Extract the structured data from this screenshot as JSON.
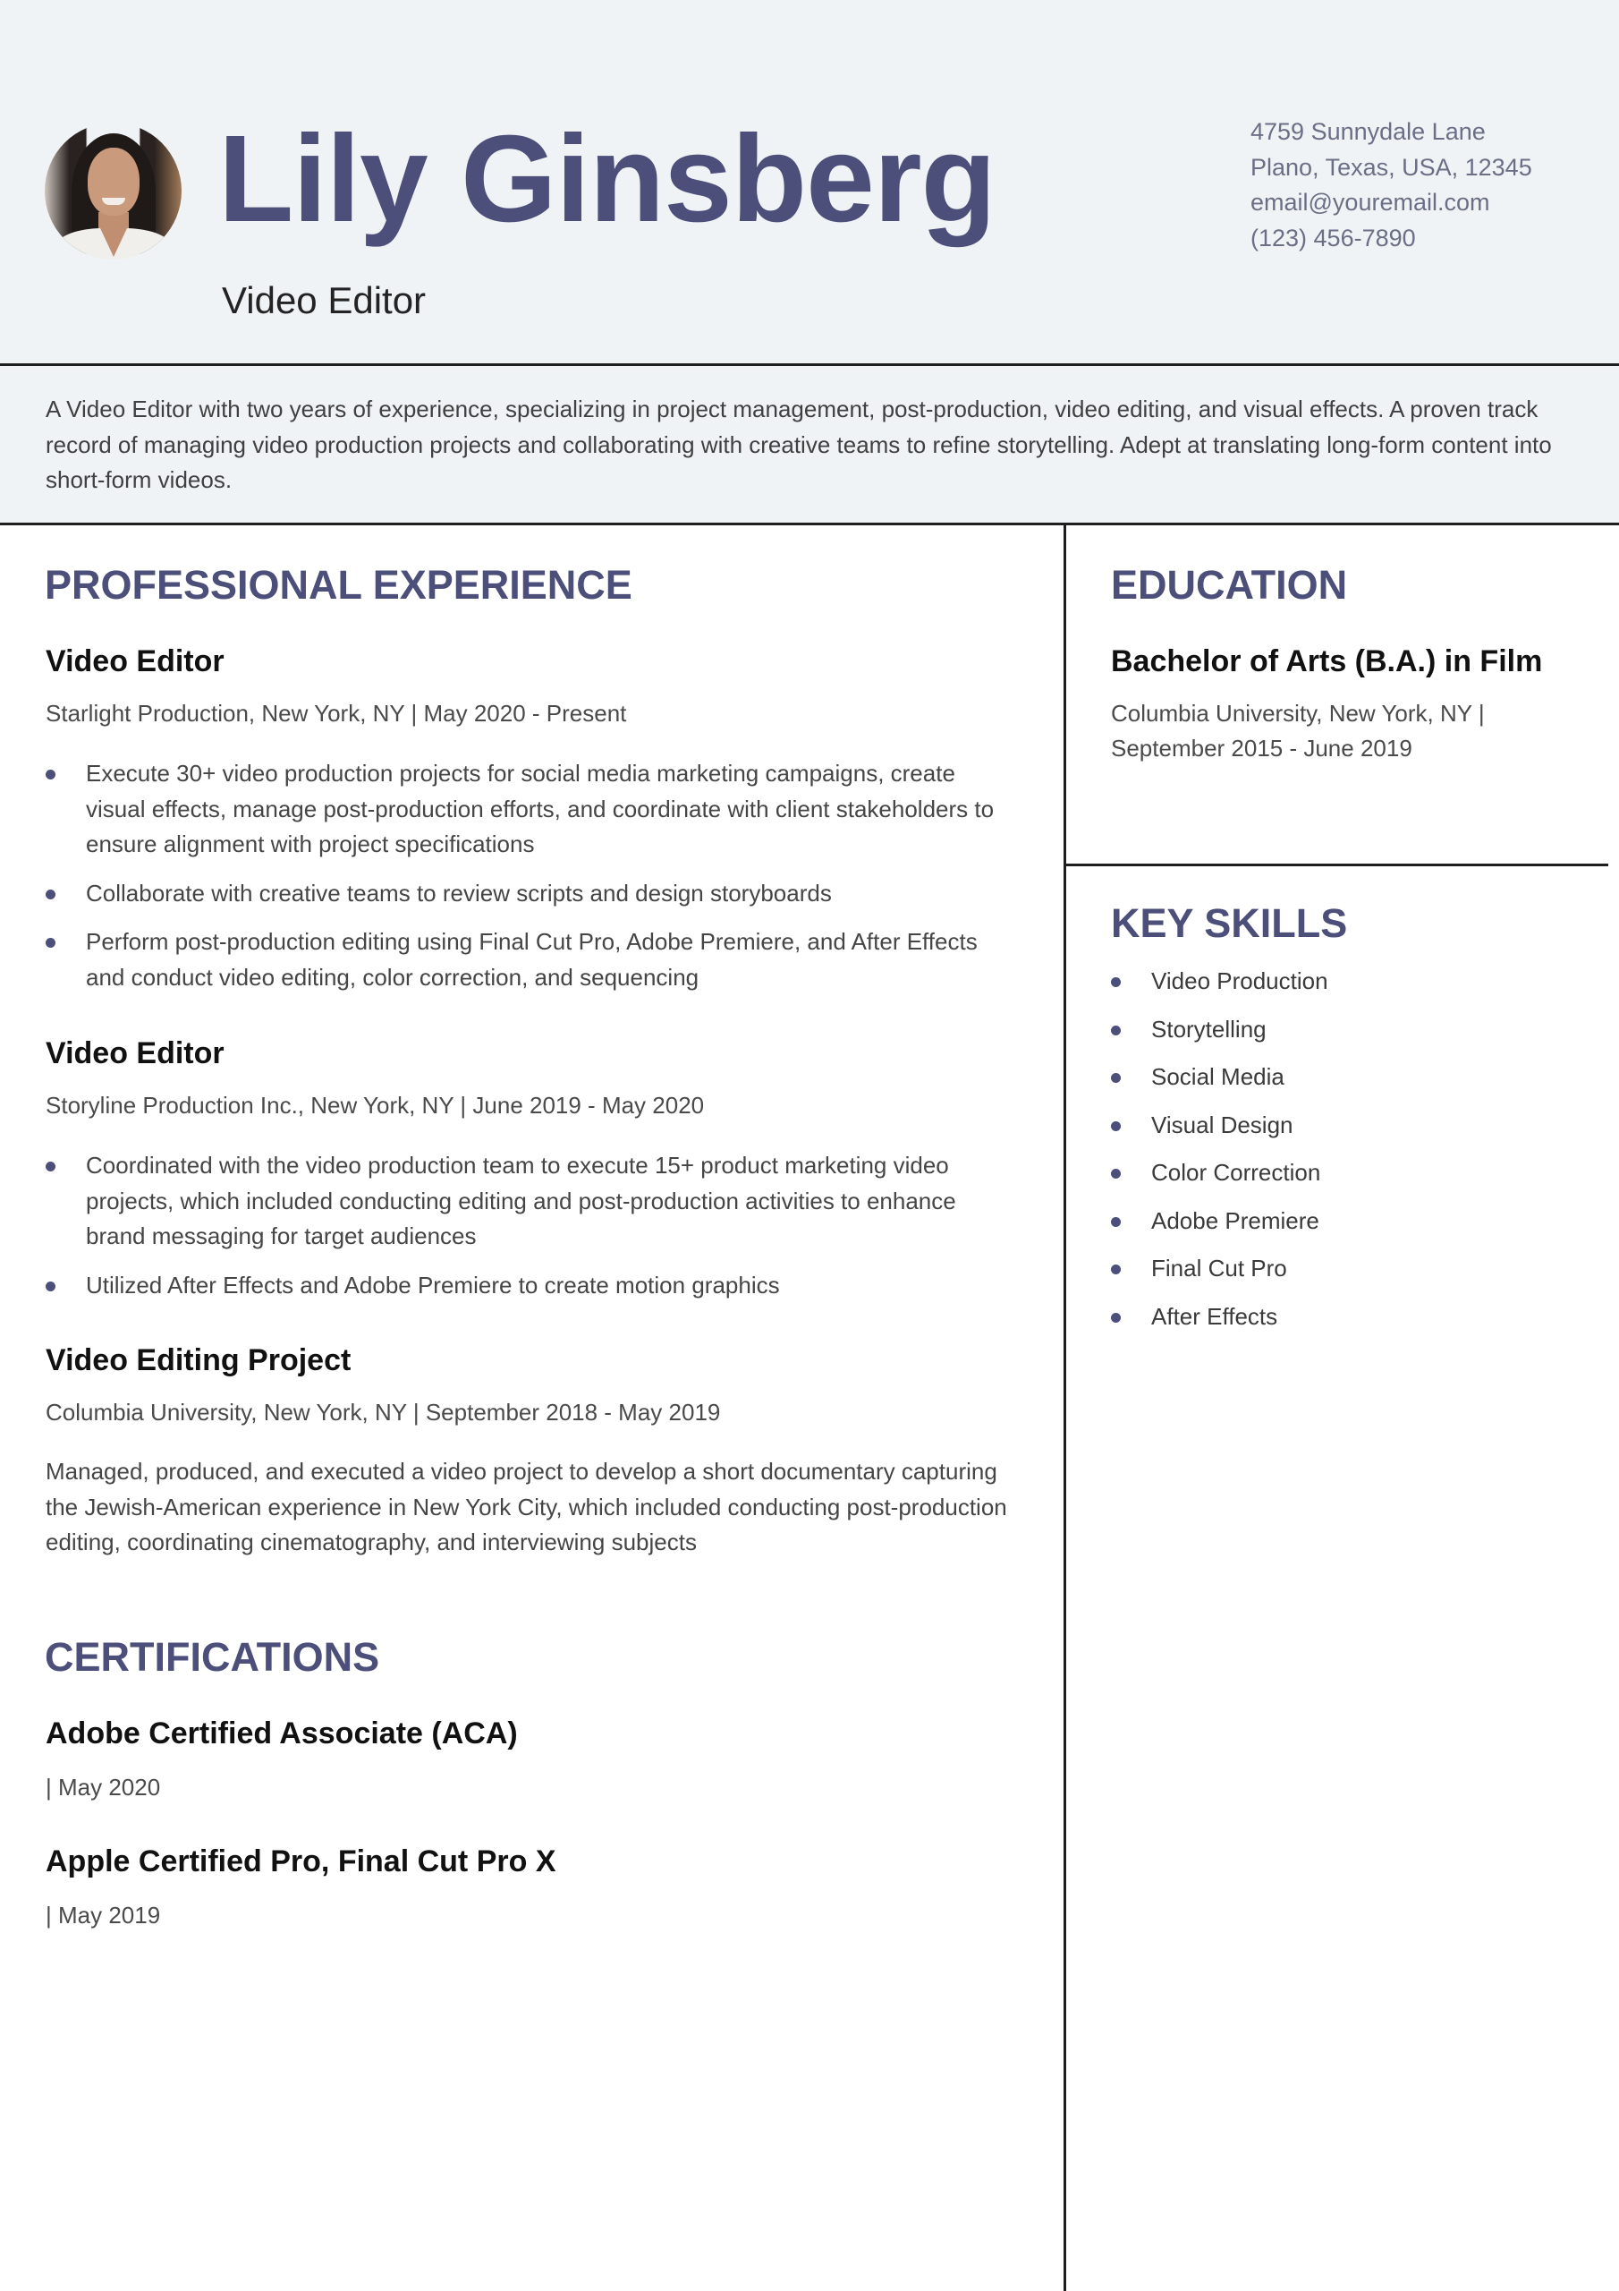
{
  "header": {
    "name": "Lily Ginsberg",
    "role": "Video Editor",
    "contact": {
      "address_line1": "4759 Sunnydale Lane",
      "address_line2": "Plano, Texas, USA, 12345",
      "email": "email@youremail.com",
      "phone": "(123) 456-7890"
    }
  },
  "summary": "A Video Editor with two years of experience, specializing in project management, post-production, video editing, and visual effects. A proven track record of managing video production projects and collaborating with creative teams to refine storytelling. Adept at translating long-form content into short-form videos.",
  "colors": {
    "accent": "#4b4f7a",
    "header_background": "#eff3f5",
    "divider": "#1e1e1e"
  },
  "experience": {
    "title": "PROFESSIONAL EXPERIENCE",
    "items": [
      {
        "title": "Video Editor",
        "meta": "Starlight Production, New York, NY | May 2020 - Present",
        "bullets": [
          "Execute 30+ video production projects for social media marketing campaigns, create visual effects, manage post-production efforts, and coordinate with client stakeholders to ensure alignment with project specifications",
          "Collaborate with creative teams to review scripts and design storyboards",
          "Perform post-production editing using Final Cut Pro, Adobe Premiere, and After Effects and conduct video editing, color correction, and sequencing"
        ]
      },
      {
        "title": "Video Editor",
        "meta": "Storyline Production Inc., New York, NY | June 2019 - May 2020",
        "bullets": [
          "Coordinated with the video production team to execute 15+ product marketing video projects, which included conducting editing and post-production activities to enhance brand messaging for target audiences",
          "Utilized After Effects and Adobe Premiere to create motion graphics"
        ]
      },
      {
        "title": "Video Editing Project",
        "meta": "Columbia University, New York, NY | September 2018 - May 2019",
        "description": "Managed, produced, and executed a video project to develop a short documentary capturing the Jewish-American experience in New York City, which included conducting post-production editing, coordinating cinematography, and interviewing subjects"
      }
    ]
  },
  "certifications": {
    "title": "CERTIFICATIONS",
    "items": [
      {
        "title": "Adobe Certified Associate (ACA)",
        "date": "| May 2020"
      },
      {
        "title": "Apple Certified Pro, Final Cut Pro X",
        "date": "| May 2019"
      }
    ]
  },
  "education": {
    "title": "EDUCATION",
    "degree": "Bachelor of Arts (B.A.) in Film",
    "school_line": "Columbia University, New York, NY |",
    "dates": "September 2015 - June 2019"
  },
  "skills": {
    "title": "KEY SKILLS",
    "items": [
      "Video Production",
      "Storytelling",
      "Social Media",
      "Visual Design",
      "Color Correction",
      "Adobe Premiere",
      "Final Cut Pro",
      "After Effects"
    ]
  }
}
